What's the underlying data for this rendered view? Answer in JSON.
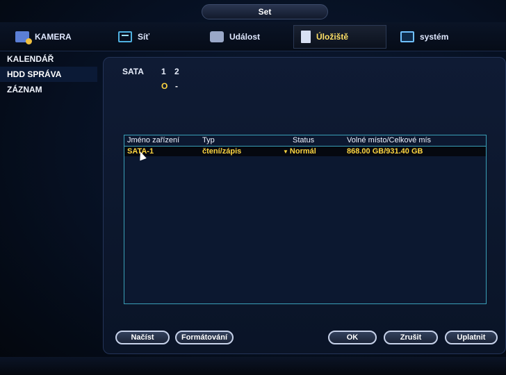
{
  "window": {
    "title": "Set"
  },
  "topnav": {
    "items": [
      {
        "label": "KAMERA",
        "icon": "camera-icon"
      },
      {
        "label": "Síť",
        "icon": "network-icon"
      },
      {
        "label": "Událost",
        "icon": "event-icon"
      },
      {
        "label": "Úložiště",
        "icon": "storage-icon",
        "active": true
      },
      {
        "label": "systém",
        "icon": "system-icon"
      }
    ]
  },
  "sidebar": {
    "items": [
      {
        "label": "KALENDÁŘ"
      },
      {
        "label": "HDD SPRÁVA",
        "active": true
      },
      {
        "label": "ZÁZNAM"
      }
    ]
  },
  "disk_status": {
    "label": "SATA",
    "slots": [
      "1",
      "2"
    ],
    "states": [
      "O",
      "-"
    ]
  },
  "table": {
    "headers": [
      "Jméno zařízení",
      "Typ",
      "Status",
      "Volné místo/Celkové mís"
    ],
    "rows": [
      {
        "name": "SATA-1",
        "type": "čtení/zápis",
        "status": "Normál",
        "capacity": "868.00 GB/931.40 GB"
      }
    ]
  },
  "buttons": {
    "load": "Načíst",
    "format": "Formátování",
    "ok": "OK",
    "cancel": "Zrušit",
    "apply": "Uplatnit"
  },
  "colors": {
    "active_text": "#ffe066",
    "highlight_value": "#ffd640",
    "table_border": "#3aa0b8"
  }
}
